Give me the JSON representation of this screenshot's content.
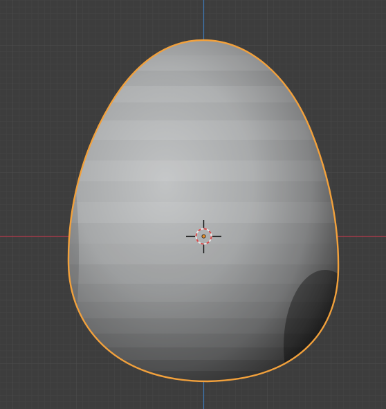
{
  "viewport": {
    "view": "3D Viewport",
    "background_color": "#3d3d3d",
    "grid_minor_color": "#464646",
    "grid_major_color": "#4c4c4c",
    "x_axis_color": "#9d3b48",
    "z_axis_color": "#3f78b3"
  },
  "object": {
    "type": "egg-mesh",
    "shading": "solid-flat",
    "selected": true,
    "outline_color": "#f2a13c",
    "body_color_light": "#c2c4c5",
    "body_color_dark": "#3a3a3a"
  },
  "origin_marker": {
    "fill_color": "#e8902a"
  },
  "cursor_3d": {
    "ring_color_a": "#e8e8e8",
    "ring_color_b": "#d94a4a",
    "crosshair_color": "#101010"
  }
}
